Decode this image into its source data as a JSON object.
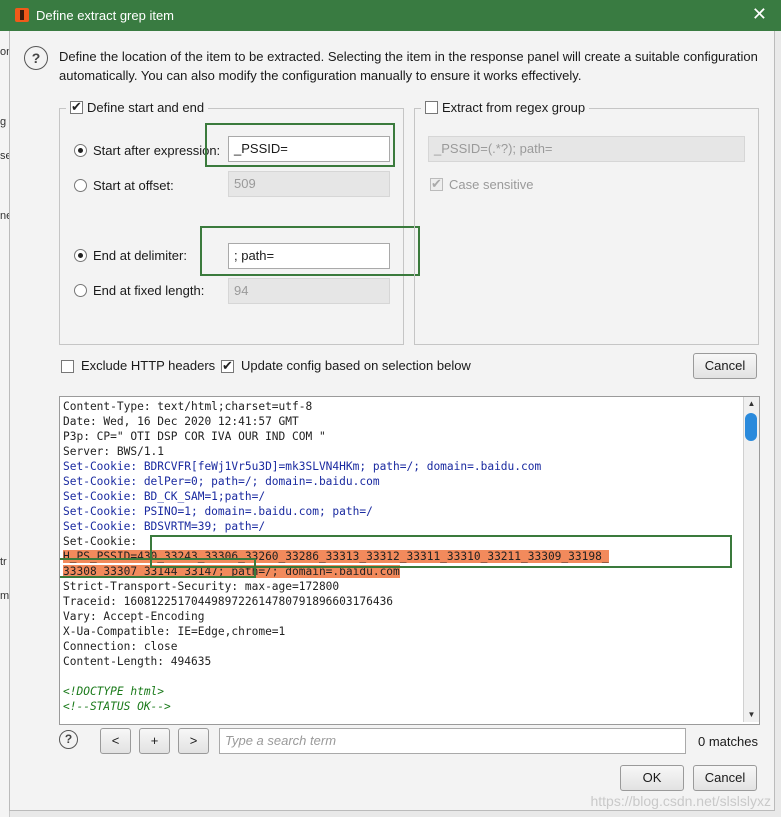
{
  "window": {
    "title": "Define extract grep item",
    "close_glyph": "✕"
  },
  "background": {
    "side_texts": [
      "on",
      "g",
      "se",
      "ne",
      "tr",
      "m"
    ]
  },
  "description": "Define the location of the item to be extracted. Selecting the item in the response panel will create a suitable configuration automatically. You can also modify the configuration manually to ensure it works effectively.",
  "help_glyph": "?",
  "start_end": {
    "checkbox_label": "Define start and end",
    "checked": true,
    "start_after_label": "Start after expression:",
    "start_after_value": "_PSSID=",
    "start_after_selected": true,
    "start_offset_label": "Start at offset:",
    "start_offset_value": "509",
    "end_delim_label": "End at delimiter:",
    "end_delim_value": "; path=",
    "end_delim_selected": true,
    "end_length_label": "End at fixed length:",
    "end_length_value": "94"
  },
  "regex": {
    "checkbox_label": "Extract from regex group",
    "checked": false,
    "value": "_PSSID=(.*?); path=",
    "case_label": "Case sensitive",
    "case_checked": true
  },
  "options": {
    "exclude_headers_label": "Exclude HTTP headers",
    "exclude_headers_checked": false,
    "update_config_label": "Update config based on selection below",
    "update_config_checked": true,
    "cancel_label": "Cancel"
  },
  "response_lines": [
    "Content-Type: text/html;charset=utf-8",
    "Date: Wed, 16 Dec 2020 12:41:57 GMT",
    "P3p: CP=\" OTI DSP COR IVA OUR IND COM \"",
    "Server: BWS/1.1",
    "Set-Cookie: BDRCVFR[feWj1Vr5u3D]=mk3SLVN4HKm; path=/; domain=.baidu.com",
    "Set-Cookie: delPer=0; path=/; domain=.baidu.com",
    "Set-Cookie: BD_CK_SAM=1;path=/",
    "Set-Cookie: PSINO=1; domain=.baidu.com; path=/",
    "Set-Cookie: BDSVRTM=39; path=/",
    "Set-Cookie:",
    "H_PS_PSSID=430_33243_33306_33260_33286_33313_33312_33311_33310_33211_33309_33198_",
    "33308_33307_33144_33147; path=/; domain=.baidu.com",
    "Strict-Transport-Security: max-age=172800",
    "Traceid: 1608122517044989722614780791896603176436",
    "Vary: Accept-Encoding",
    "X-Ua-Compatible: IE=Edge,chrome=1",
    "Connection: close",
    "Content-Length: 494635",
    "",
    "<!DOCTYPE html>",
    "<!--STATUS OK-->"
  ],
  "search": {
    "prev_label": "<",
    "add_label": "+",
    "next_label": ">",
    "placeholder": "Type a search term",
    "matches": "0 matches"
  },
  "footer": {
    "ok_label": "OK",
    "cancel_label": "Cancel"
  },
  "watermark": "https://blog.csdn.net/slslslyxz",
  "colors": {
    "titlebar": "#397b41",
    "highlight_box": "#3a7a3c",
    "selection": "#f28a5c"
  }
}
